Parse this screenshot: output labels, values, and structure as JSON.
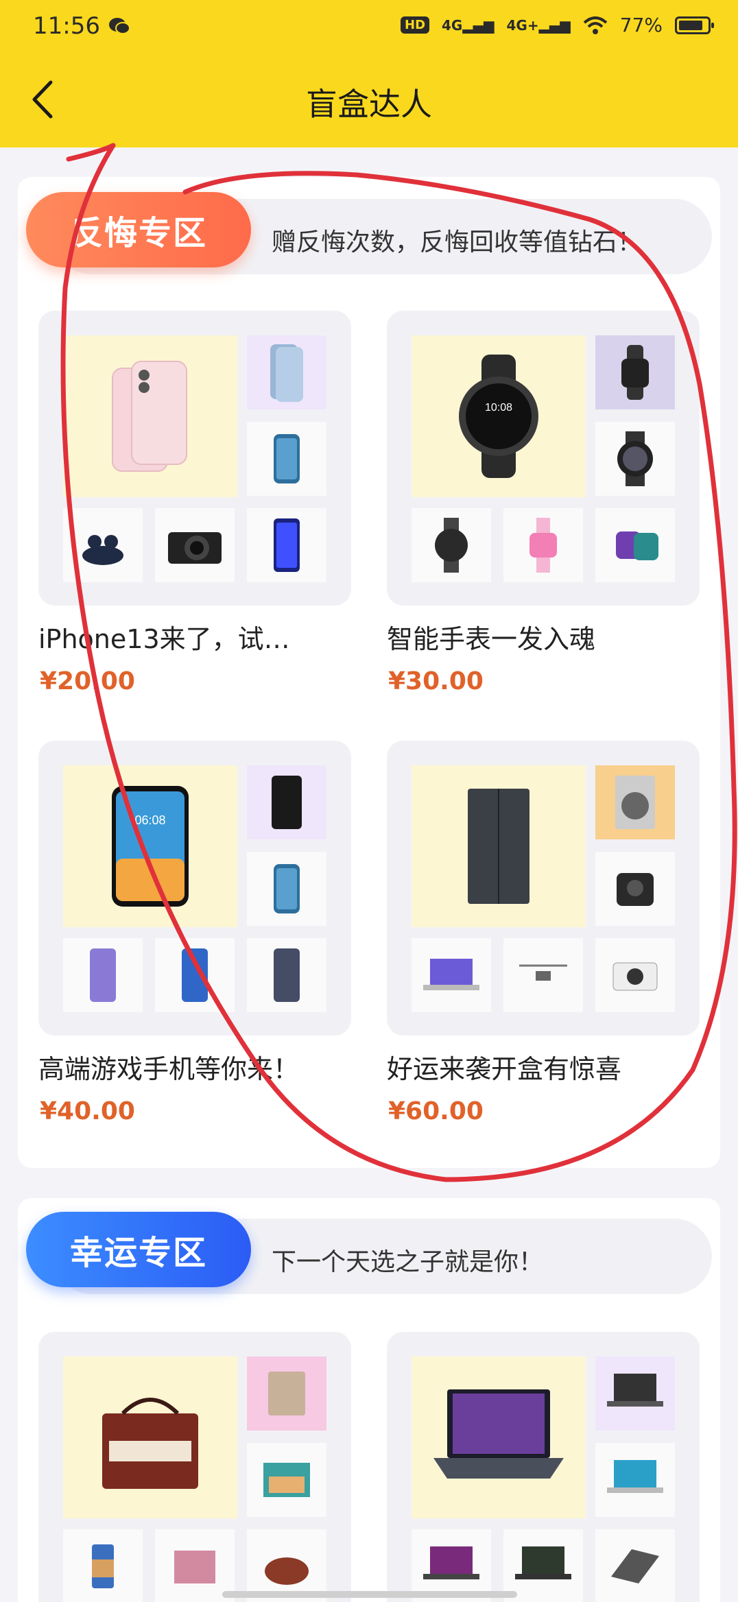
{
  "status_bar": {
    "time": "11:56",
    "net1": "4G",
    "net2": "4G+",
    "battery": "77%"
  },
  "header": {
    "title": "盲盒达人"
  },
  "sections": [
    {
      "tag": "反悔专区",
      "slogan": "赠反悔次数，反悔回收等值钻石！",
      "products": [
        {
          "name": "iPhone13来了，试…",
          "price": "¥20.00"
        },
        {
          "name": "智能手表一发入魂",
          "price": "¥30.00"
        },
        {
          "name": "高端游戏手机等你来！",
          "price": "¥40.00"
        },
        {
          "name": "好运来袭开盒有惊喜",
          "price": "¥60.00"
        }
      ]
    },
    {
      "tag": "幸运专区",
      "slogan": "下一个天选之子就是你！"
    }
  ],
  "colors": {
    "header_bg": "#f9d81e",
    "price": "#e0622a",
    "annotation": "#e0313a"
  }
}
